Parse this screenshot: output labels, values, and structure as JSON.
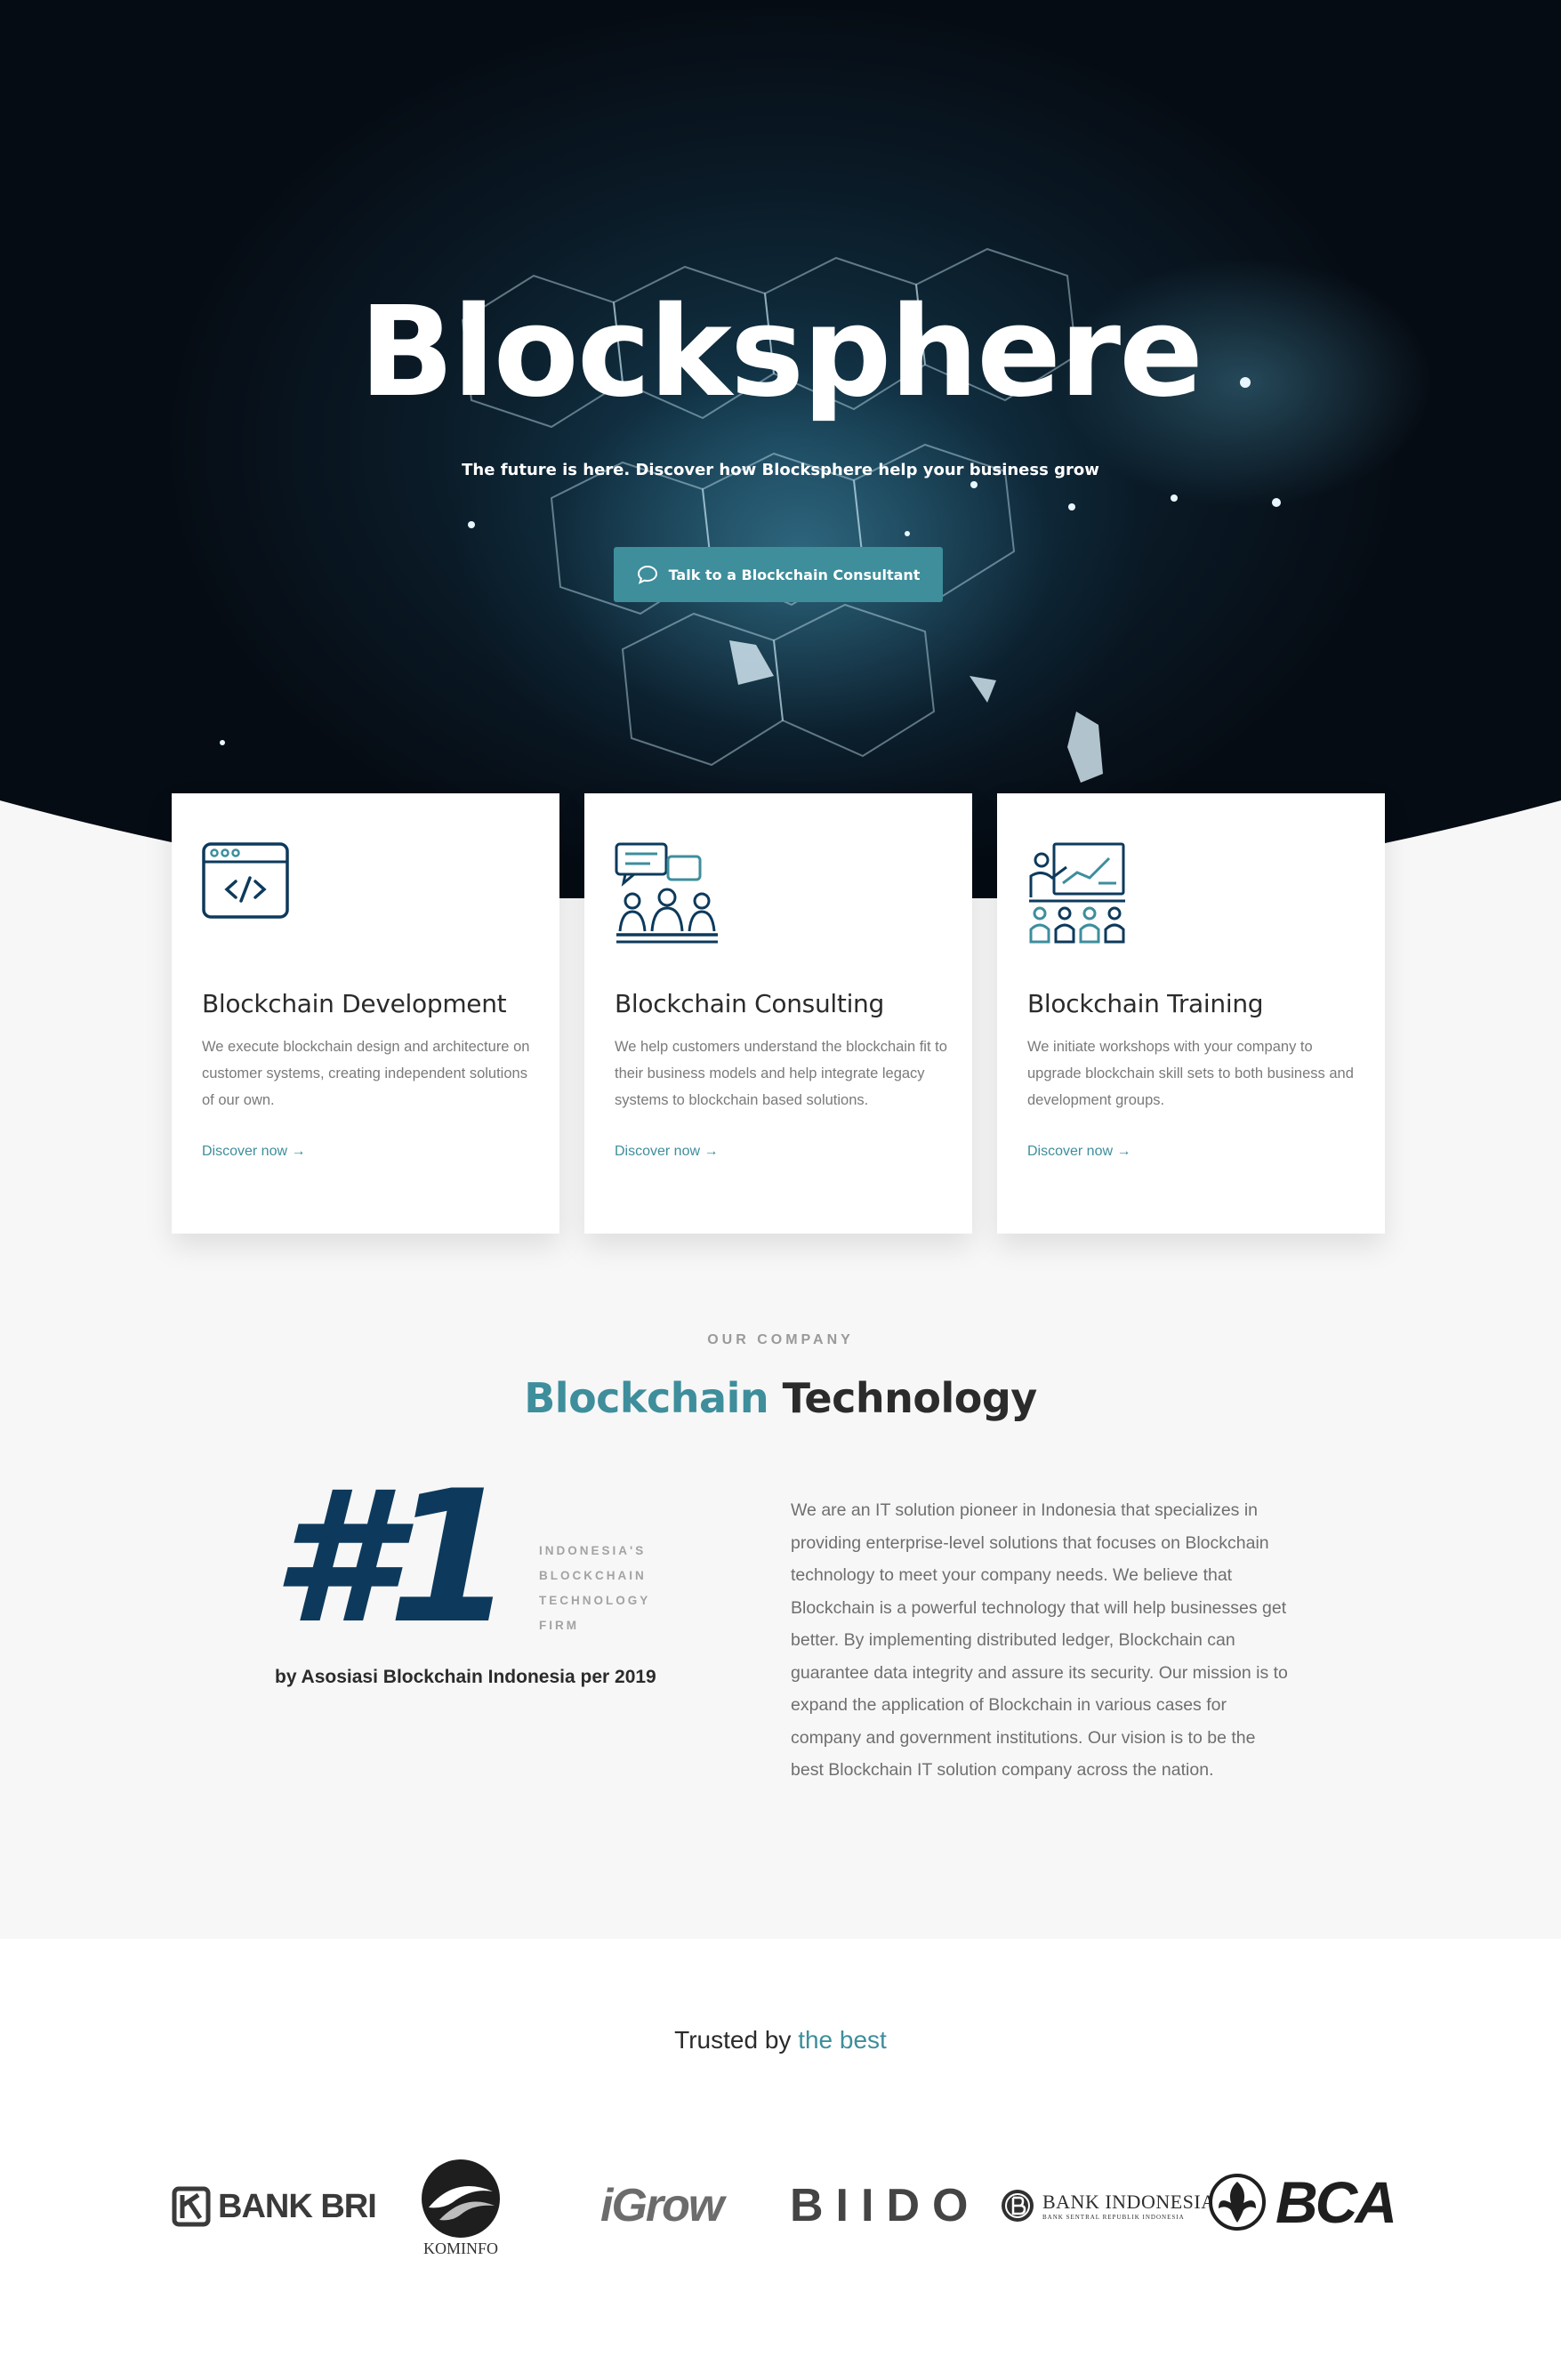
{
  "hero": {
    "title": "Blocksphere",
    "subtitle": "The future is here. Discover how Blocksphere help your business grow",
    "cta_label": "Talk to a Blockchain Consultant"
  },
  "services": [
    {
      "icon": "code-window-icon",
      "title": "Blockchain Development",
      "description": "We execute blockchain design and architecture on customer systems, creating independent solutions of our own.",
      "link": "Discover now →"
    },
    {
      "icon": "consulting-team-icon",
      "title": "Blockchain Consulting",
      "description": "We help customers understand the blockchain fit to their business models and help integrate legacy systems to blockchain based solutions.",
      "link": "Discover now →"
    },
    {
      "icon": "training-presentation-icon",
      "title": "Blockchain Training",
      "description": "We initiate workshops with your company to upgrade blockchain skill sets to both business and development groups.",
      "link": "Discover now →"
    }
  ],
  "company": {
    "eyebrow": "OUR COMPANY",
    "title_accent": "Blockchain",
    "title_rest": "Technology",
    "rank": "#1",
    "rank_tag": "INDONESIA'S BLOCKCHAIN TECHNOLOGY FIRM",
    "rank_by": "by Asosiasi Blockchain Indonesia per 2019",
    "about": "We are an IT solution pioneer in Indonesia that specializes in providing enterprise-level solutions that focuses on Blockchain technology to meet your company needs. We believe that Blockchain is a powerful technology that will help businesses get better. By implementing distributed ledger, Blockchain can guarantee data integrity and assure its security. Our mission is to expand the application of Blockchain in various cases for company and government institutions. Our vision is to be the best Blockchain IT solution company across the nation."
  },
  "trusted": {
    "title_start": "Trusted by",
    "title_accent": "the best",
    "logos": {
      "bri": "BANK BRI",
      "kominfo": "KOMINFO",
      "igrow": "iGrow",
      "biido": "BIIDO",
      "bi_main": "BANK INDONESIA",
      "bi_small": "BANK SENTRAL REPUBLIK INDONESIA",
      "bca": "BCA"
    }
  },
  "colors": {
    "accent": "#3e8e9c",
    "navy": "#0d3a5c",
    "hero_bg": "#0a1a26"
  }
}
